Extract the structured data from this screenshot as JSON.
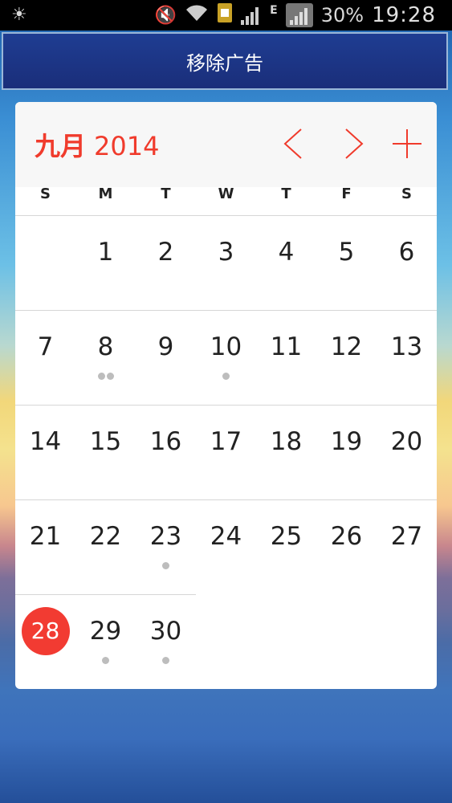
{
  "status_bar": {
    "battery": "30%",
    "time": "19:28",
    "network_type": "E",
    "icons": [
      "brightness-icon",
      "mute-icon",
      "wifi-icon",
      "sim-icon",
      "signal-icon",
      "signal-box-icon"
    ]
  },
  "banner": {
    "label": "移除广告"
  },
  "calendar": {
    "month": "九月",
    "year": "2014",
    "accent_color": "#f03b2c",
    "weekdays": [
      "S",
      "M",
      "T",
      "W",
      "T",
      "F",
      "S"
    ],
    "weeks": [
      [
        null,
        {
          "d": "1",
          "dots": 0
        },
        {
          "d": "2",
          "dots": 0
        },
        {
          "d": "3",
          "dots": 0
        },
        {
          "d": "4",
          "dots": 0
        },
        {
          "d": "5",
          "dots": 0
        },
        {
          "d": "6",
          "dots": 0
        }
      ],
      [
        {
          "d": "7",
          "dots": 0
        },
        {
          "d": "8",
          "dots": 2
        },
        {
          "d": "9",
          "dots": 0
        },
        {
          "d": "10",
          "dots": 1
        },
        {
          "d": "11",
          "dots": 0
        },
        {
          "d": "12",
          "dots": 0
        },
        {
          "d": "13",
          "dots": 0
        }
      ],
      [
        {
          "d": "14",
          "dots": 0
        },
        {
          "d": "15",
          "dots": 0
        },
        {
          "d": "16",
          "dots": 0
        },
        {
          "d": "17",
          "dots": 0
        },
        {
          "d": "18",
          "dots": 0
        },
        {
          "d": "19",
          "dots": 0
        },
        {
          "d": "20",
          "dots": 0
        }
      ],
      [
        {
          "d": "21",
          "dots": 0
        },
        {
          "d": "22",
          "dots": 0
        },
        {
          "d": "23",
          "dots": 1
        },
        {
          "d": "24",
          "dots": 0
        },
        {
          "d": "25",
          "dots": 0
        },
        {
          "d": "26",
          "dots": 0
        },
        {
          "d": "27",
          "dots": 0
        }
      ],
      [
        {
          "d": "28",
          "dots": 0,
          "today": true
        },
        {
          "d": "29",
          "dots": 1
        },
        {
          "d": "30",
          "dots": 1
        },
        null,
        null,
        null,
        null
      ]
    ]
  }
}
